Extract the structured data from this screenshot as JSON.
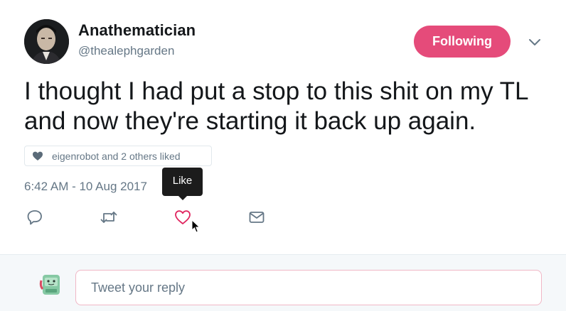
{
  "author": {
    "name": "Anathematician",
    "handle": "@thealephgarden"
  },
  "follow_button": {
    "label": "Following",
    "color": "#e0245e"
  },
  "tweet": {
    "text": "I thought I had put a stop to this shit on my TL and now they're starting it back up again.",
    "liked_by": "eigenrobot and 2 others liked",
    "timestamp": "6:42 AM - 10 Aug 2017"
  },
  "tooltip": {
    "label": "Like"
  },
  "actions": {
    "icons": [
      "reply-icon",
      "retweet-icon",
      "like-icon",
      "direct-message-icon"
    ],
    "like_color": "#e0245e",
    "icon_color": "#657786"
  },
  "reply": {
    "placeholder": "Tweet your reply"
  }
}
